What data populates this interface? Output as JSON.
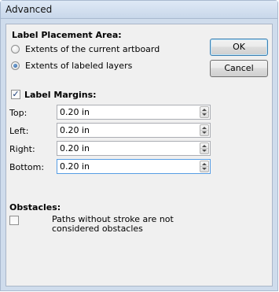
{
  "window": {
    "title": "Advanced"
  },
  "placement": {
    "heading": "Label Placement Area:",
    "options": [
      {
        "label": "Extents of the current artboard",
        "selected": false
      },
      {
        "label": "Extents of labeled layers",
        "selected": true
      }
    ]
  },
  "buttons": {
    "ok": "OK",
    "cancel": "Cancel"
  },
  "margins": {
    "enabled": true,
    "check_mark": "✓",
    "heading": "Label Margins:",
    "fields": [
      {
        "label": "Top:",
        "value": "0.20 in"
      },
      {
        "label": "Left:",
        "value": "0.20 in"
      },
      {
        "label": "Right:",
        "value": "0.20 in"
      },
      {
        "label": "Bottom:",
        "value": "0.20 in"
      }
    ]
  },
  "obstacles": {
    "heading": "Obstacles:",
    "checked": false,
    "option_label": "Paths without stroke are not considered obstacles"
  }
}
